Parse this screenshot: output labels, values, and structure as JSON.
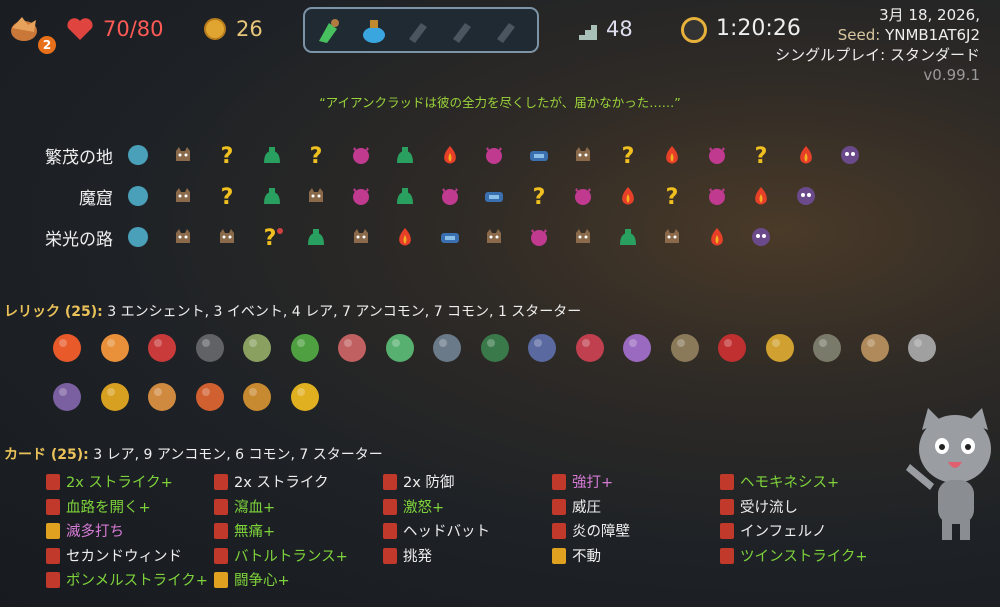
{
  "topbar": {
    "hp": "70/80",
    "ascension": "2",
    "gold": "26",
    "floor": "48",
    "time": "1:20:26",
    "date": "3月 18, 2026,",
    "seed_label": "Seed:",
    "seed": "YNMB1AT6J2",
    "mode": "シングルプレイ: スタンダード",
    "version": "v0.99.1",
    "potions": [
      "potion-green-hand",
      "potion-blue-flask",
      "empty-slot",
      "empty-slot",
      "empty-slot"
    ]
  },
  "quote": "“アイアンクラッドは彼の全力を尽くしたが、届かなかった……”",
  "acts": [
    {
      "label": "繁茂の地",
      "nodes": [
        "act-icon",
        "monster",
        "unknown",
        "treasure",
        "unknown",
        "elite",
        "treasure",
        "rest",
        "elite",
        "shop",
        "monster",
        "unknown",
        "rest",
        "elite",
        "unknown",
        "rest",
        "boss"
      ]
    },
    {
      "label": "魔窟",
      "nodes": [
        "act-icon",
        "monster",
        "unknown",
        "treasure",
        "monster",
        "elite",
        "treasure",
        "elite",
        "shop",
        "unknown",
        "elite",
        "rest",
        "unknown",
        "elite",
        "rest",
        "boss"
      ]
    },
    {
      "label": "栄光の路",
      "nodes": [
        "act-icon",
        "monster",
        "monster",
        "unknown-special",
        "treasure",
        "monster",
        "rest",
        "shop",
        "monster",
        "elite",
        "monster",
        "treasure",
        "monster",
        "rest",
        "boss"
      ]
    }
  ],
  "relics_heading": {
    "key": "レリック (25):",
    "value": "3 エンシェント, 3 イベント, 4 レア, 7 アンコモン, 7 コモン, 1 スターター"
  },
  "relic_colors": [
    "#e85a2a",
    "#e8903a",
    "#c93a3a",
    "#606266",
    "#8aa060",
    "#4ea040",
    "#c06060",
    "#58b070",
    "#6a7a88",
    "#3a7a4a",
    "#5a6aa0",
    "#c04050",
    "#9a6ac0",
    "#8a7a5a",
    "#c03030",
    "#d0a030",
    "#7a7a6a",
    "#b08a5a",
    "#a0a0a0",
    "#7a60a0",
    "#d8a020",
    "#d08a40",
    "#d06030",
    "#c88a30",
    "#e0b020"
  ],
  "cards_heading": {
    "key": "カード (25):",
    "value": "3 レア, 9 アンコモン, 6 コモン, 7 スターター"
  },
  "cards": [
    [
      {
        "label": "2x ストライク+",
        "cls": "g",
        "icon": "#c0392b"
      },
      {
        "label": "血路を開く+",
        "cls": "g",
        "icon": "#c0392b"
      },
      {
        "label": "滅多打ち",
        "cls": "p",
        "icon": "#e0a020"
      },
      {
        "label": "セカンドウィンド",
        "cls": "w",
        "icon": "#c0392b"
      },
      {
        "label": "ポンメルストライク+",
        "cls": "g",
        "icon": "#c0392b"
      }
    ],
    [
      {
        "label": "2x ストライク",
        "cls": "w",
        "icon": "#c0392b"
      },
      {
        "label": "瀉血+",
        "cls": "g",
        "icon": "#c0392b"
      },
      {
        "label": "無痛+",
        "cls": "g",
        "icon": "#c0392b"
      },
      {
        "label": "バトルトランス+",
        "cls": "g",
        "icon": "#c0392b"
      },
      {
        "label": "闘争心+",
        "cls": "g",
        "icon": "#e0a020"
      }
    ],
    [
      {
        "label": "2x 防御",
        "cls": "w",
        "icon": "#c0392b"
      },
      {
        "label": "激怒+",
        "cls": "g",
        "icon": "#c0392b"
      },
      {
        "label": "ヘッドバット",
        "cls": "w",
        "icon": "#c0392b"
      },
      {
        "label": "挑発",
        "cls": "w",
        "icon": "#c0392b"
      }
    ],
    [
      {
        "label": "強打+",
        "cls": "p",
        "icon": "#c0392b"
      },
      {
        "label": "威圧",
        "cls": "w",
        "icon": "#c0392b"
      },
      {
        "label": "炎の障壁",
        "cls": "w",
        "icon": "#c0392b"
      },
      {
        "label": "不動",
        "cls": "w",
        "icon": "#e0a020"
      }
    ],
    [
      {
        "label": "ヘモキネシス+",
        "cls": "g",
        "icon": "#c0392b"
      },
      {
        "label": "受け流し",
        "cls": "w",
        "icon": "#c0392b"
      },
      {
        "label": "インフェルノ",
        "cls": "w",
        "icon": "#c0392b"
      },
      {
        "label": "ツインストライク+",
        "cls": "g",
        "icon": "#c0392b"
      }
    ]
  ]
}
